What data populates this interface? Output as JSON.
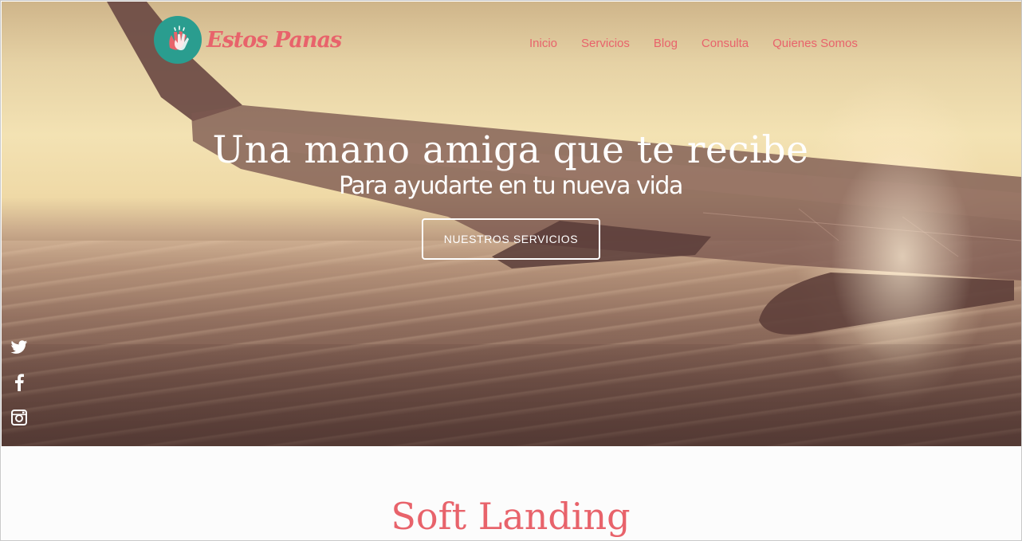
{
  "brand": {
    "name": "Estos Panas",
    "logo_icon": "high-five-hands-icon",
    "colors": {
      "accent": "#e8636b",
      "teal": "#2a9d8f"
    }
  },
  "nav": {
    "items": [
      {
        "label": "Inicio"
      },
      {
        "label": "Servicios"
      },
      {
        "label": "Blog"
      },
      {
        "label": "Consulta"
      },
      {
        "label": "Quienes Somos"
      }
    ]
  },
  "hero": {
    "title": "Una mano amiga que te recibe",
    "subtitle": "Para ayudarte en tu nueva vida",
    "cta_label": "NUESTROS SERVICIOS",
    "background": "airplane-wing-over-coast"
  },
  "social": {
    "icons": [
      "twitter-icon",
      "facebook-icon",
      "instagram-icon"
    ]
  },
  "section": {
    "title": "Soft Landing"
  }
}
